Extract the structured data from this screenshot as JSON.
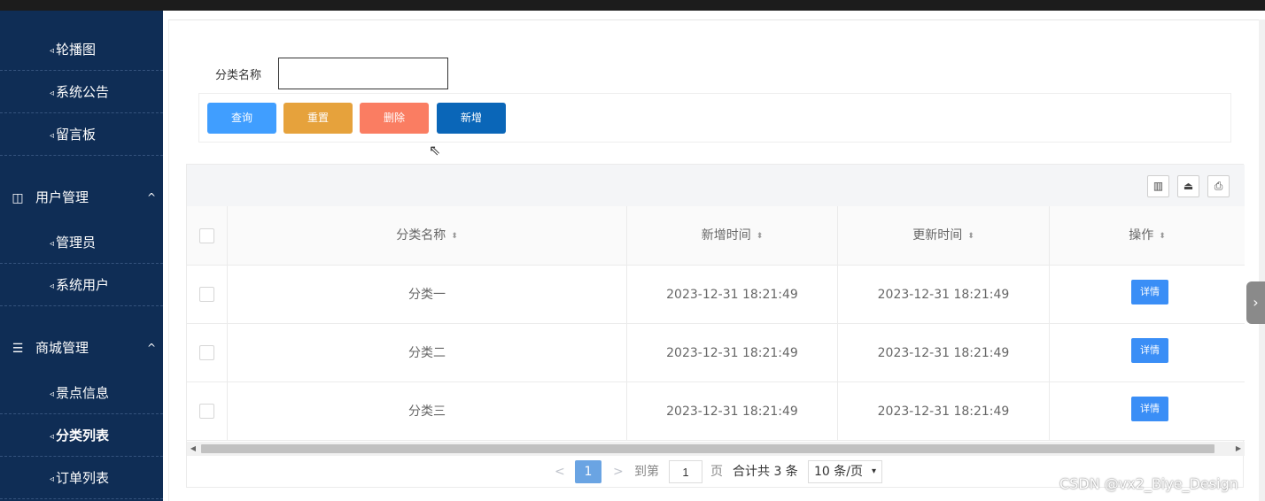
{
  "sidebar": {
    "top_items": [
      {
        "label": "轮播图"
      },
      {
        "label": "系统公告"
      },
      {
        "label": "留言板"
      }
    ],
    "groups": [
      {
        "label": "用户管理",
        "icon": "book-icon",
        "items": [
          {
            "label": "管理员"
          },
          {
            "label": "系统用户"
          }
        ]
      },
      {
        "label": "商城管理",
        "icon": "list-icon",
        "items": [
          {
            "label": "景点信息"
          },
          {
            "label": "分类列表"
          },
          {
            "label": "订单列表"
          }
        ]
      }
    ],
    "chevron": "^",
    "tri": "◃"
  },
  "search": {
    "label": "分类名称",
    "value": "",
    "placeholder": ""
  },
  "buttons": {
    "query": "查询",
    "reset": "重置",
    "delete": "删除",
    "add": "新增",
    "colors": {
      "query": "#409eff",
      "reset": "#e6a23c",
      "delete": "#fa7d62",
      "add": "#0a66b8"
    }
  },
  "table": {
    "columns": [
      "分类名称",
      "新增时间",
      "更新时间",
      "操作"
    ],
    "sort_glyph": "⬍",
    "rows": [
      {
        "name": "分类一",
        "created": "2023-12-31 18:21:49",
        "updated": "2023-12-31 18:21:49",
        "action": "详情"
      },
      {
        "name": "分类二",
        "created": "2023-12-31 18:21:49",
        "updated": "2023-12-31 18:21:49",
        "action": "详情"
      },
      {
        "name": "分类三",
        "created": "2023-12-31 18:21:49",
        "updated": "2023-12-31 18:21:49",
        "action": "详情"
      }
    ]
  },
  "pagination": {
    "prev": "<",
    "current": "1",
    "next": ">",
    "goto_label": "到第",
    "goto_value": "1",
    "page_suffix": "页",
    "total": "合计共 3 条",
    "page_size": "10 条/页"
  },
  "watermark": "CSDN @vx2_Biye_Design"
}
